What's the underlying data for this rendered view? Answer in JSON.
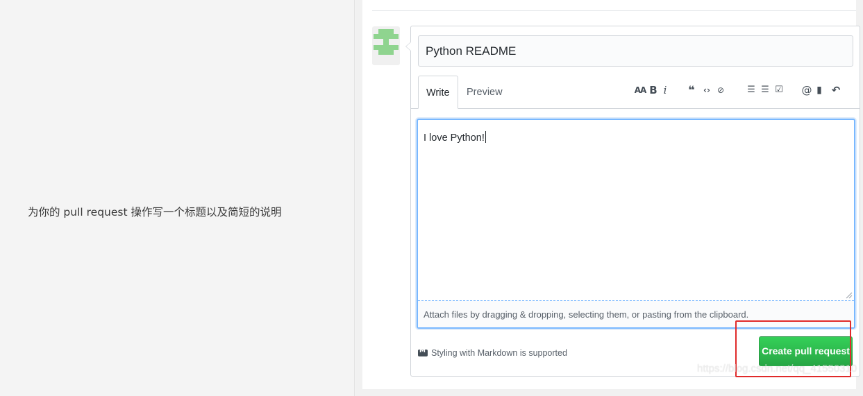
{
  "instruction": "为你的 pull request 操作写一个标题以及简短的说明",
  "form": {
    "title_value": "Python README",
    "tabs": [
      {
        "label": "Write",
        "active": true
      },
      {
        "label": "Preview",
        "active": false
      }
    ],
    "toolbar": [
      {
        "icon": "header-icon",
        "glyph": "AA"
      },
      {
        "icon": "bold-icon",
        "glyph": "B"
      },
      {
        "icon": "italic-icon",
        "glyph": "i"
      },
      {
        "icon": "quote-icon",
        "glyph": "❝"
      },
      {
        "icon": "code-icon",
        "glyph": "‹›"
      },
      {
        "icon": "link-icon",
        "glyph": "⊘"
      },
      {
        "icon": "unordered-list-icon",
        "glyph": "☰"
      },
      {
        "icon": "ordered-list-icon",
        "glyph": "☰"
      },
      {
        "icon": "task-list-icon",
        "glyph": "☑"
      },
      {
        "icon": "mention-icon",
        "glyph": "@"
      },
      {
        "icon": "reference-icon",
        "glyph": "▮"
      },
      {
        "icon": "reply-icon",
        "glyph": "↶"
      }
    ],
    "body_value": "I love Python!",
    "attach_hint": "Attach files by dragging & dropping, selecting them, or pasting from the clipboard.",
    "markdown_note": "Styling with Markdown is supported",
    "submit_label": "Create pull request"
  },
  "watermark": "https://blog.csdn.net/qq_41550310",
  "colors": {
    "submit_green": "#28a745",
    "focus_blue": "#79b8ff",
    "highlight_red": "#e02a2a",
    "avatar_green": "#8fd48f"
  }
}
